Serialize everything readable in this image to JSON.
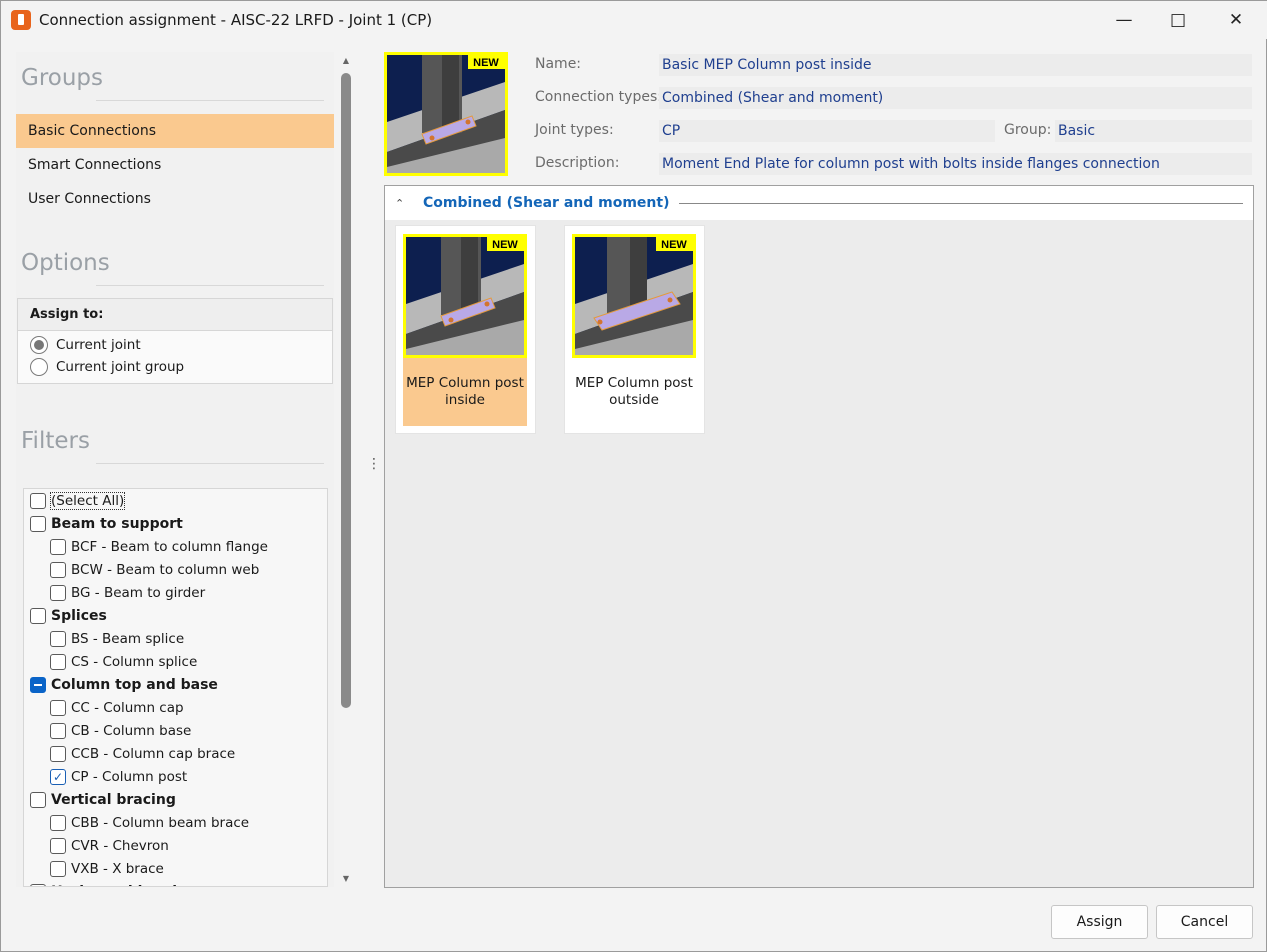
{
  "window": {
    "title": "Connection assignment - AISC-22 LRFD - Joint 1 (CP)"
  },
  "groups": {
    "heading": "Groups",
    "items": [
      "Basic Connections",
      "Smart Connections",
      "User Connections"
    ],
    "selected": 0
  },
  "options": {
    "heading": "Options",
    "assign_to_label": "Assign to:",
    "radios": [
      {
        "label": "Current joint",
        "selected": true
      },
      {
        "label": "Current joint group",
        "selected": false
      }
    ]
  },
  "filters": {
    "heading": "Filters",
    "items": [
      {
        "label": "(Select All)",
        "level": 0,
        "bold": false,
        "state": "unchecked"
      },
      {
        "label": "Beam to support",
        "level": 0,
        "bold": true,
        "state": "unchecked"
      },
      {
        "label": "BCF - Beam to column flange",
        "level": 1,
        "bold": false,
        "state": "unchecked"
      },
      {
        "label": "BCW - Beam to column web",
        "level": 1,
        "bold": false,
        "state": "unchecked"
      },
      {
        "label": "BG - Beam to girder",
        "level": 1,
        "bold": false,
        "state": "unchecked"
      },
      {
        "label": "Splices",
        "level": 0,
        "bold": true,
        "state": "unchecked"
      },
      {
        "label": "BS - Beam splice",
        "level": 1,
        "bold": false,
        "state": "unchecked"
      },
      {
        "label": "CS - Column splice",
        "level": 1,
        "bold": false,
        "state": "unchecked"
      },
      {
        "label": "Column top and base",
        "level": 0,
        "bold": true,
        "state": "indeterminate"
      },
      {
        "label": "CC - Column cap",
        "level": 1,
        "bold": false,
        "state": "unchecked"
      },
      {
        "label": "CB - Column base",
        "level": 1,
        "bold": false,
        "state": "unchecked"
      },
      {
        "label": "CCB - Column cap brace",
        "level": 1,
        "bold": false,
        "state": "unchecked"
      },
      {
        "label": "CP - Column post",
        "level": 1,
        "bold": false,
        "state": "checked"
      },
      {
        "label": "Vertical bracing",
        "level": 0,
        "bold": true,
        "state": "unchecked"
      },
      {
        "label": "CBB - Column beam brace",
        "level": 1,
        "bold": false,
        "state": "unchecked"
      },
      {
        "label": "CVR - Chevron",
        "level": 1,
        "bold": false,
        "state": "unchecked"
      },
      {
        "label": "VXB - X brace",
        "level": 1,
        "bold": false,
        "state": "unchecked"
      },
      {
        "label": "Horizontal bracing",
        "level": 0,
        "bold": true,
        "state": "unchecked"
      }
    ]
  },
  "details": {
    "name_label": "Name:",
    "name": "Basic MEP Column post inside",
    "conn_types_label": "Connection types:",
    "conn_types": "Combined (Shear and moment)",
    "joint_types_label": "Joint types:",
    "joint_types": "CP",
    "group_label": "Group:",
    "group": "Basic",
    "description_label": "Description:",
    "description": "Moment End Plate for column post with bolts inside flanges connection",
    "badge": "NEW"
  },
  "section": {
    "title": "Combined (Shear and moment)"
  },
  "cards": [
    {
      "label": "MEP Column post inside",
      "badge": "NEW",
      "selected": true
    },
    {
      "label": "MEP Column post outside",
      "badge": "NEW",
      "selected": false
    }
  ],
  "buttons": {
    "assign": "Assign",
    "cancel": "Cancel"
  }
}
